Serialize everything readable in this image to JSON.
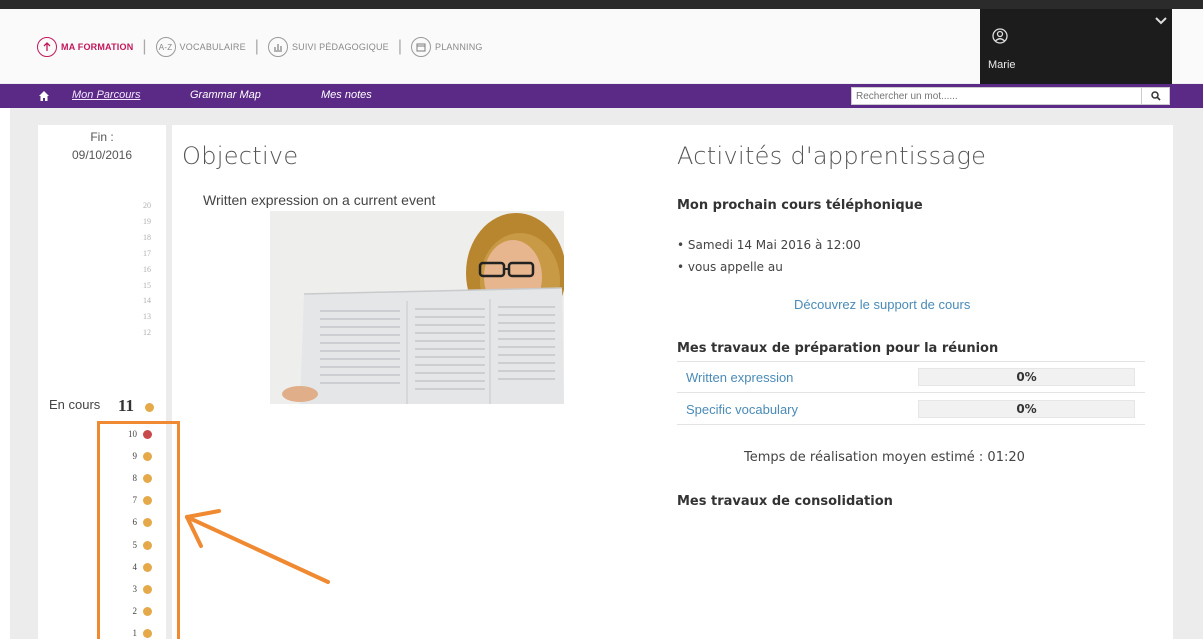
{
  "header": {
    "nav": [
      {
        "label": "MA FORMATION",
        "icon": "upload-circle-icon",
        "active": true
      },
      {
        "label": "VOCABULAIRE",
        "icon": "az-dictionary-icon",
        "active": false
      },
      {
        "label": "SUIVI PÉDAGOGIQUE",
        "icon": "chart-icon",
        "active": false
      },
      {
        "label": "PLANNING",
        "icon": "calendar-icon",
        "active": false
      }
    ],
    "user_name": "Marie"
  },
  "subnav": {
    "items": [
      "Mon Parcours",
      "Grammar Map",
      "Mes notes"
    ],
    "active_index": 0,
    "search_placeholder": "Rechercher un mot......"
  },
  "timeline": {
    "fin_label": "Fin :",
    "fin_date": "09/10/2016",
    "future_steps": [
      "20",
      "19",
      "18",
      "17",
      "16",
      "15",
      "14",
      "13",
      "12"
    ],
    "current_label": "En cours",
    "current_step": "11",
    "done_steps": [
      "10",
      "9",
      "8",
      "7",
      "6",
      "5",
      "4",
      "3",
      "2",
      "1"
    ],
    "colors": {
      "done_dot": "#e5a94a",
      "alert_dot": "#c84b4b",
      "highlight": "#f08a32"
    }
  },
  "objective": {
    "title": "Objective",
    "text": "Written expression on a current event"
  },
  "activities": {
    "title": "Activités d'apprentissage",
    "next_call_heading": "Mon prochain cours téléphonique",
    "call_items": [
      "Samedi 14 Mai 2016 à 12:00",
      "vous appelle au"
    ],
    "support_link": "Découvrez le support de cours",
    "prep_heading": "Mes travaux de préparation pour la réunion",
    "prep_items": [
      {
        "label": "Written expression",
        "progress": "0%"
      },
      {
        "label": "Specific vocabulary",
        "progress": "0%"
      }
    ],
    "temps": "Temps de réalisation moyen estimé : 01:20",
    "consolidation_heading": "Mes travaux de consolidation"
  },
  "colors": {
    "brand_purple": "#5b2a86",
    "active_nav": "#c2185b",
    "link": "#4a8bb7"
  }
}
